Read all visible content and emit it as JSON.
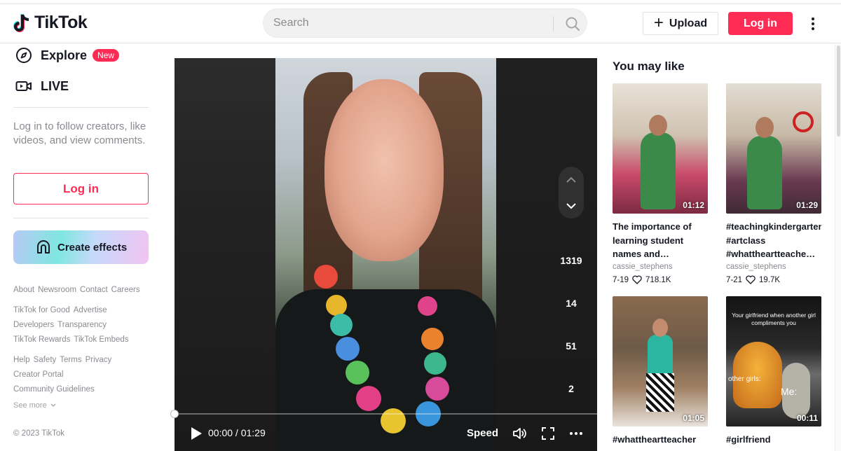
{
  "header": {
    "logo_text": "TikTok",
    "search_placeholder": "Search",
    "upload_label": "Upload",
    "login_label": "Log in"
  },
  "sidebar": {
    "nav": [
      {
        "label": "Explore",
        "badge": "New",
        "icon": "compass-icon"
      },
      {
        "label": "LIVE",
        "icon": "live-camera-icon"
      }
    ],
    "login_prompt": "Log in to follow creators, like videos, and view comments.",
    "login_button": "Log in",
    "create_effects": "Create effects",
    "footer_rows": [
      [
        "About",
        "Newsroom",
        "Contact",
        "Careers"
      ],
      [
        "TikTok for Good",
        "Advertise"
      ],
      [
        "Developers",
        "Transparency"
      ],
      [
        "TikTok Rewards",
        "TikTok Embeds"
      ],
      [
        "Help",
        "Safety",
        "Terms",
        "Privacy"
      ],
      [
        "Creator Portal"
      ],
      [
        "Community Guidelines"
      ]
    ],
    "see_more": "See more",
    "copyright": "© 2023 TikTok"
  },
  "video": {
    "counts": [
      "1319",
      "14",
      "51",
      "2"
    ],
    "time": "00:00 / 01:29",
    "speed_label": "Speed",
    "progress": 0.0
  },
  "you_may_like": {
    "title": "You may like",
    "cards": [
      {
        "title": "The importance of learning student names and…",
        "author": "cassie_stephens",
        "date": "7-19",
        "likes": "718.1K",
        "duration": "01:12"
      },
      {
        "title": "#teachingkindergarten #artclass #whattheartteache…",
        "author": "cassie_stephens",
        "date": "7-21",
        "likes": "19.7K",
        "duration": "01:29"
      },
      {
        "title": "#whattheartteacher wore #artclass",
        "author": "",
        "date": "",
        "likes": "",
        "duration": "01:05"
      },
      {
        "title": "#girlfriend #compliments #fyp",
        "author": "",
        "date": "",
        "likes": "",
        "duration": "00:11",
        "overlay_text": "Your girlfriend when another girl compliments you",
        "overlay_label_1": "other girls:",
        "overlay_label_2": "Me:"
      }
    ]
  }
}
